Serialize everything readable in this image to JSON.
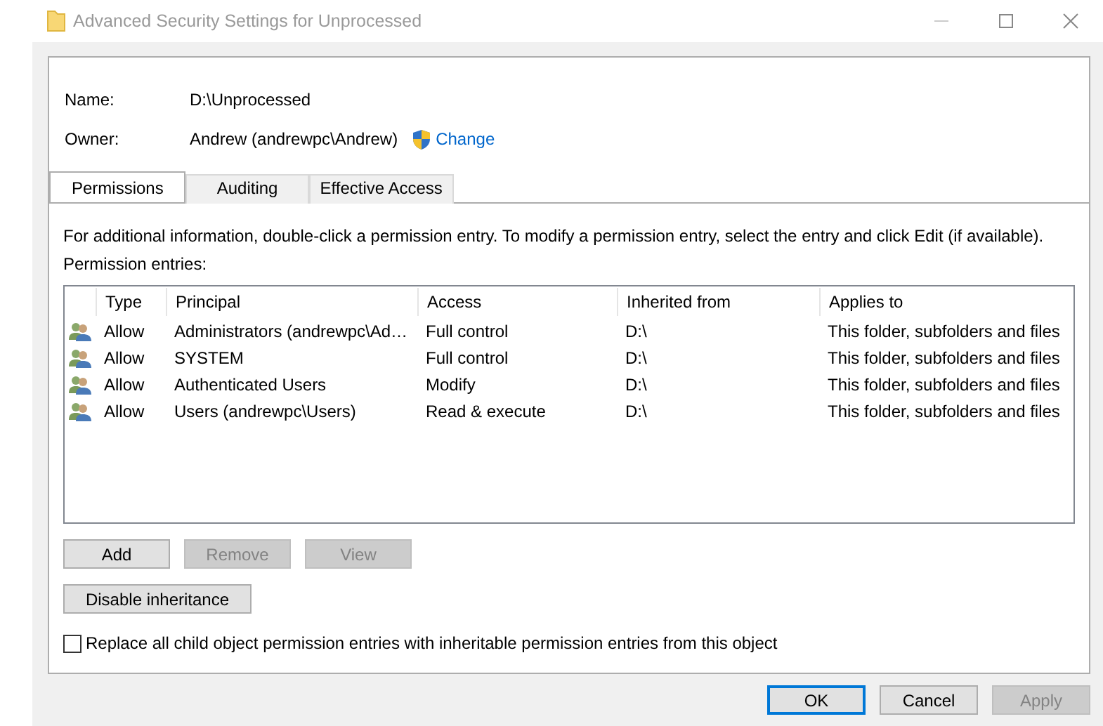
{
  "window": {
    "title": "Advanced Security Settings for Unprocessed"
  },
  "fields": [
    {
      "label": "Name:",
      "value": "D:\\Unprocessed"
    },
    {
      "label": "Owner:",
      "value": "Andrew (andrewpc\\Andrew)",
      "link": "Change"
    }
  ],
  "tabs": [
    {
      "label": "Permissions",
      "selected": true
    },
    {
      "label": "Auditing",
      "selected": false
    },
    {
      "label": "Effective Access",
      "selected": false
    }
  ],
  "info_text": "For additional information, double-click a permission entry. To modify a permission entry, select the entry and click Edit (if available).",
  "list_label": "Permission entries:",
  "table": {
    "columns": [
      "Type",
      "Principal",
      "Access",
      "Inherited from",
      "Applies to"
    ],
    "rows": [
      {
        "cells": [
          "Allow",
          "Administrators (andrewpc\\Ad…",
          "Full control",
          "D:\\",
          "This folder, subfolders and files"
        ],
        "selected": false
      },
      {
        "cells": [
          "Allow",
          "SYSTEM",
          "Full control",
          "D:\\",
          "This folder, subfolders and files"
        ],
        "selected": false
      },
      {
        "cells": [
          "Allow",
          "Authenticated Users",
          "Modify",
          "D:\\",
          "This folder, subfolders and files"
        ],
        "selected": false
      },
      {
        "cells": [
          "Allow",
          "Users (andrewpc\\Users)",
          "Read & execute",
          "D:\\",
          "This folder, subfolders and files"
        ],
        "selected": false
      }
    ]
  },
  "entry_buttons": [
    {
      "label": "Add",
      "disabled": false
    },
    {
      "label": "Remove",
      "disabled": true
    },
    {
      "label": "View",
      "disabled": true
    }
  ],
  "inheritance_button": {
    "label": "Disable inheritance",
    "disabled": false
  },
  "replace_checkbox": {
    "label": "Replace all child object permission entries with inheritable permission entries from this object",
    "checked": false
  },
  "dialog_buttons": [
    {
      "label": "OK",
      "disabled": false,
      "default": true
    },
    {
      "label": "Cancel",
      "disabled": false,
      "default": false
    },
    {
      "label": "Apply",
      "disabled": true,
      "default": false
    }
  ]
}
